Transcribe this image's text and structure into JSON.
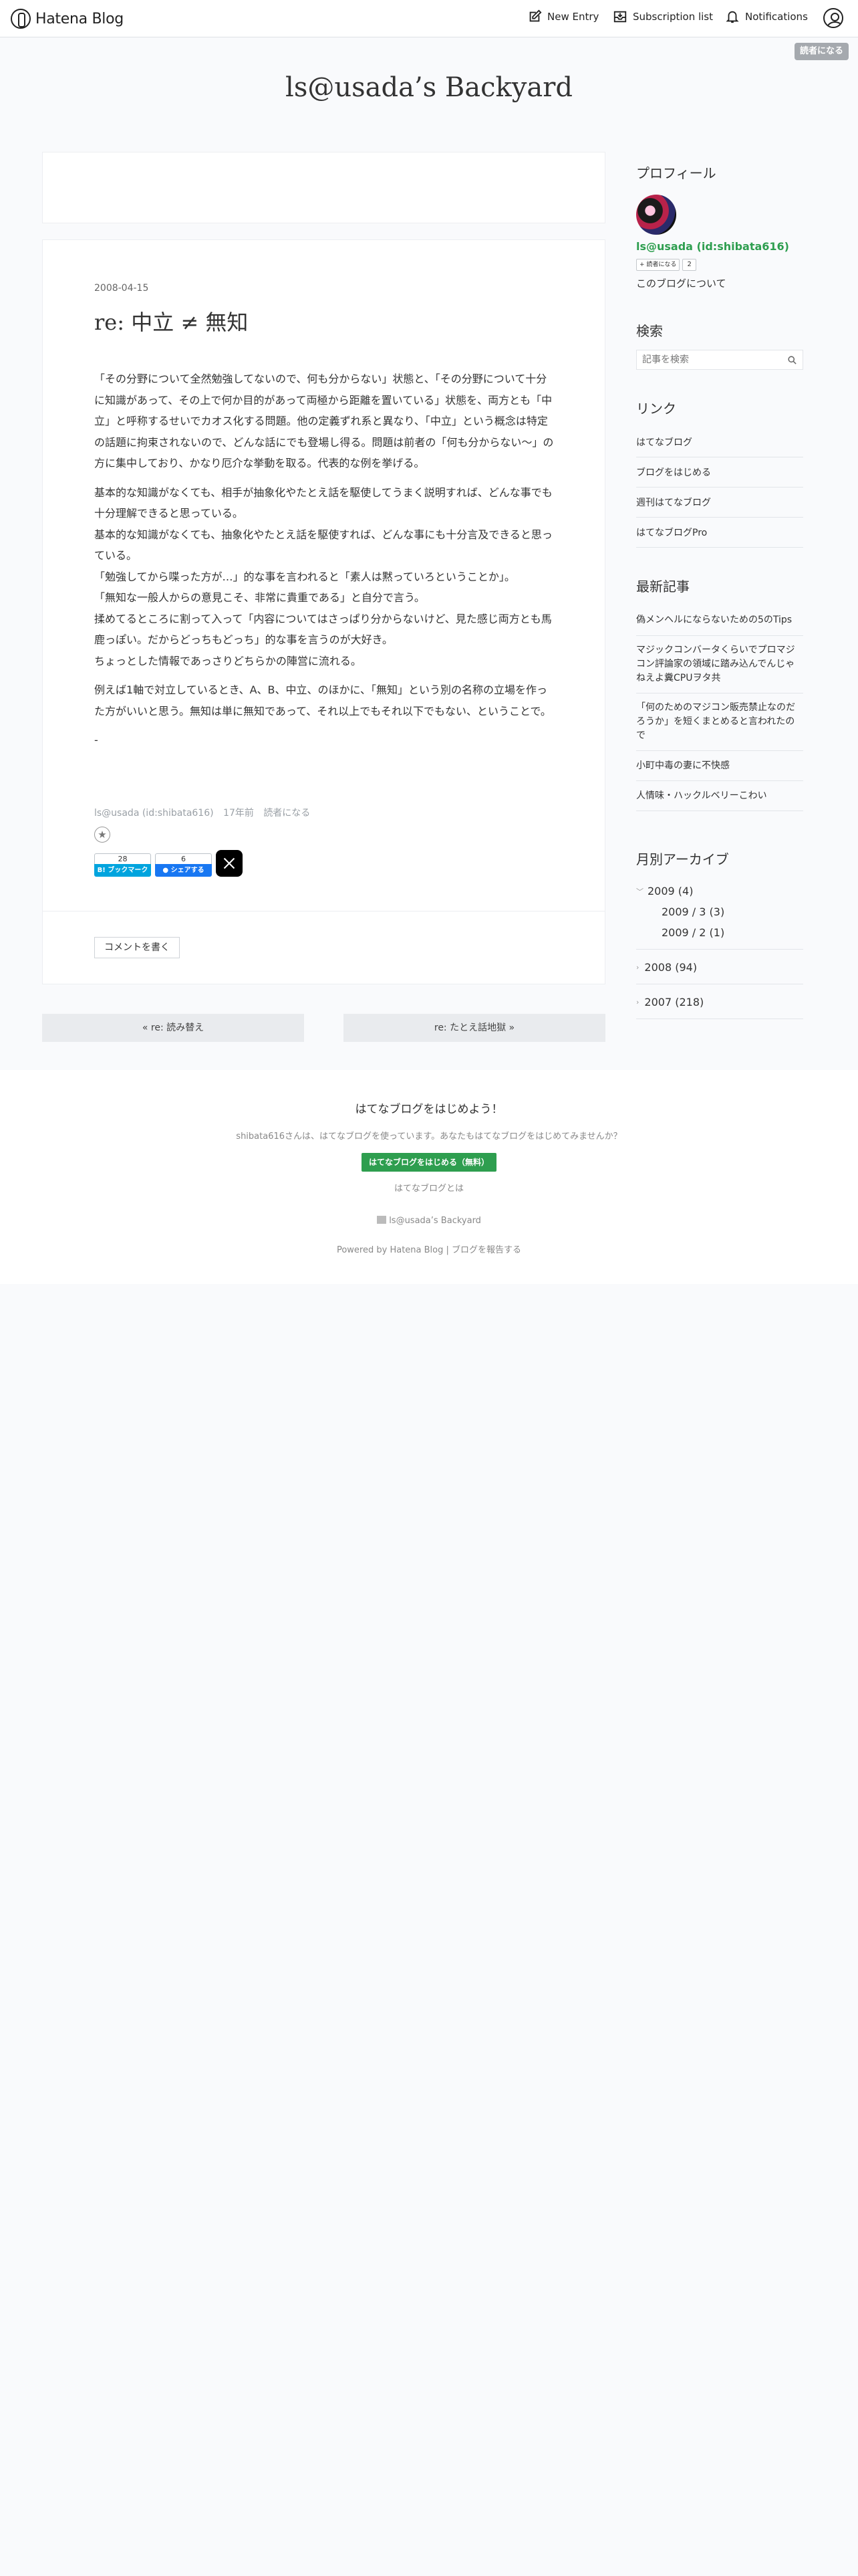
{
  "header": {
    "logo_text": "Hatena Blog",
    "new_entry": "New Entry",
    "subscription_list": "Subscription list",
    "notifications": "Notifications",
    "subscribe_pill": "読者になる"
  },
  "blog": {
    "title": "ls@usada’s Backyard"
  },
  "entry": {
    "date": "2008-04-15",
    "title": "re: 中立 ≠ 無知",
    "paragraphs": [
      [
        "「その分野について全然勉強してないので、何も分からない」状態と、「その分野について十分に知識があって、その上で何か目的があって両極から距離を置いている」状態を、両方とも「中立」と呼称するせいでカオス化する問題。他の定義ずれ系と異なり、「中立」という概念は特定の話題に拘束されないので、どんな話にでも登場し得る。問題は前者の「何も分からない〜」の方に集中しており、かなり厄介な挙動を取る。代表的な例を挙げる。"
      ],
      [
        "基本的な知識がなくても、相手が抽象化やたとえ話を駆使してうまく説明すれば、どんな事でも十分理解できると思っている。",
        "基本的な知識がなくても、抽象化やたとえ話を駆使すれば、どんな事にも十分言及できると思っている。",
        "「勉強してから喋った方が…」的な事を言われると「素人は黙っていろということか」。",
        "「無知な一般人からの意見こそ、非常に貴重である」と自分で言う。",
        "揉めてるところに割って入って「内容についてはさっぱり分からないけど、見た感じ両方とも馬鹿っぽい。だからどっちもどっち」的な事を言うのが大好き。",
        "ちょっとした情報であっさりどちらかの陣営に流れる。"
      ],
      [
        "例えば1軸で対立しているとき、A、B、中立、のほかに、「無知」という別の名称の立場を作った方がいいと思う。無知は単に無知であって、それ以上でもそれ以下でもない、ということで。"
      ],
      [
        "-"
      ]
    ],
    "meta_author": "ls@usada (id:shibata616)",
    "meta_time": "17年前",
    "meta_reader": "読者になる",
    "star_icon": "star-add-icon",
    "bookmark_count": "28",
    "bookmark_label": "B! ブックマーク",
    "facebook_count": "6",
    "facebook_label": "シェアする",
    "comment_button": "コメントを書く"
  },
  "pager": {
    "prev": "« re: 読み替え",
    "next": "re: たとえ話地獄 »"
  },
  "sidebar": {
    "profile_heading": "プロフィール",
    "profile_name": "ls@usada (id:shibata616)",
    "reader_label": "読者になる",
    "reader_count": "2",
    "about_link": "このブログについて",
    "search_heading": "検索",
    "search_placeholder": "記事を検索",
    "links_heading": "リンク",
    "links": [
      "はてなブログ",
      "ブログをはじめる",
      "週刊はてなブログ",
      "はてなブログPro"
    ],
    "recent_heading": "最新記事",
    "recent": [
      "偽メンヘルにならないための5のTips",
      "マジックコンバータくらいでプロマジコン評論家の領域に踏み込んでんじゃねえよ糞CPUヲタ共",
      "「何のためのマジコン販売禁止なのだろうか」を短くまとめると言われたので",
      "小町中毒の妻に不快感",
      "人情味・ハックルベリーこわい"
    ],
    "archive_heading": "月別アーカイブ",
    "archive_2009": "2009 (4)",
    "archive_2009_3": "2009 / 3 (3)",
    "archive_2009_2": "2009 / 2 (1)",
    "archive_2008": "2008 (94)",
    "archive_2007": "2007 (218)"
  },
  "footer": {
    "heading": "はてなブログをはじめよう！",
    "text": "shibata616さんは、はてなブログを使っています。あなたもはてなブログをはじめてみませんか？",
    "cta": "はてなブログをはじめる（無料）",
    "about": "はてなブログとは",
    "blog_name": "ls@usada’s Backyard",
    "powered": "Powered by Hatena Blog",
    "report": "ブログを報告する"
  }
}
